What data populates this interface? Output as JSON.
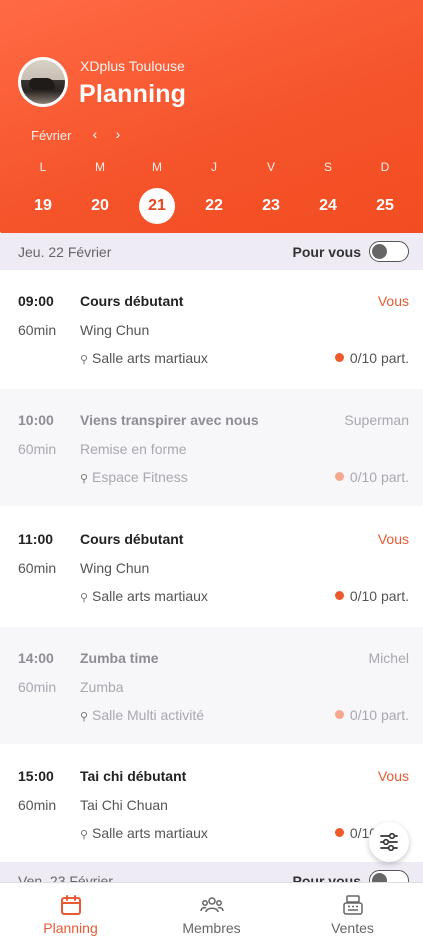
{
  "header": {
    "club_name": "XDplus Toulouse",
    "title": "Planning",
    "month": "Février",
    "prev_icon": "chevron-left-icon",
    "next_icon": "chevron-right-icon",
    "days": [
      {
        "letter": "L",
        "num": "19",
        "selected": false
      },
      {
        "letter": "M",
        "num": "20",
        "selected": false
      },
      {
        "letter": "M",
        "num": "21",
        "selected": true
      },
      {
        "letter": "J",
        "num": "22",
        "selected": false
      },
      {
        "letter": "V",
        "num": "23",
        "selected": false
      },
      {
        "letter": "S",
        "num": "24",
        "selected": false
      },
      {
        "letter": "D",
        "num": "25",
        "selected": false
      }
    ]
  },
  "filter": {
    "date_label": "Jeu. 22 Février",
    "pour_vous_label": "Pour vous",
    "pour_vous_on": false
  },
  "sessions": [
    {
      "time": "09:00",
      "duration": "60min",
      "title": "Cours débutant",
      "type": "Wing Chun",
      "room": "Salle arts martiaux",
      "coach": "Vous",
      "participants_count": "0",
      "participants_rest": "/10 part.",
      "dim": false
    },
    {
      "time": "10:00",
      "duration": "60min",
      "title": "Viens transpirer avec nous",
      "type": "Remise en forme",
      "room": "Espace Fitness",
      "coach": "Superman",
      "participants_count": "0",
      "participants_rest": "/10 part.",
      "dim": true
    },
    {
      "time": "11:00",
      "duration": "60min",
      "title": "Cours débutant",
      "type": "Wing Chun",
      "room": "Salle arts martiaux",
      "coach": "Vous",
      "participants_count": "0",
      "participants_rest": "/10 part.",
      "dim": false
    },
    {
      "time": "14:00",
      "duration": "60min",
      "title": "Zumba time",
      "type": "Zumba",
      "room": "Salle Multi activité",
      "coach": "Michel",
      "participants_count": "0",
      "participants_rest": "/10 part.",
      "dim": true
    },
    {
      "time": "15:00",
      "duration": "60min",
      "title": "Tai chi débutant",
      "type": "Tai Chi Chuan",
      "room": "Salle arts martiaux",
      "coach": "Vous",
      "participants_count": "0",
      "participants_rest": "/10 part.",
      "dim": false
    }
  ],
  "next_day": {
    "date_label": "Ven. 23 Février",
    "pour_vous_label": "Pour vous"
  },
  "tabs": [
    {
      "label": "Planning",
      "icon": "calendar-icon",
      "active": true
    },
    {
      "label": "Membres",
      "icon": "members-icon",
      "active": false
    },
    {
      "label": "Ventes",
      "icon": "cash-register-icon",
      "active": false
    }
  ],
  "colors": {
    "accent": "#f5532a",
    "active_tab": "#e85a33",
    "dot": "#ef5a2c"
  }
}
